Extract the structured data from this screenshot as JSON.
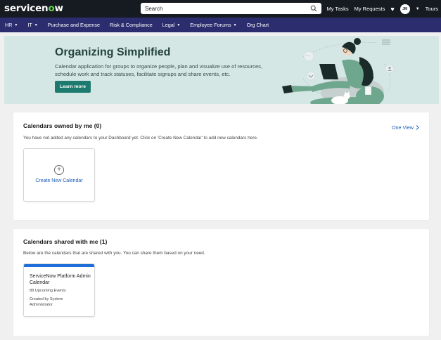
{
  "header": {
    "logo_text": "servicenow",
    "search_placeholder": "Search",
    "my_tasks": "My Tasks",
    "my_requests": "My Requests",
    "avatar_initials": "JM",
    "tours": "Tours"
  },
  "nav": {
    "items": [
      {
        "label": "HR",
        "has_dropdown": true
      },
      {
        "label": "IT",
        "has_dropdown": true
      },
      {
        "label": "Purchase and Expense",
        "has_dropdown": false
      },
      {
        "label": "Risk & Compliance",
        "has_dropdown": false
      },
      {
        "label": "Legal",
        "has_dropdown": true
      },
      {
        "label": "Employee Forums",
        "has_dropdown": true
      },
      {
        "label": "Org Chart",
        "has_dropdown": false
      }
    ]
  },
  "banner": {
    "title": "Organizing Simplified",
    "description": "Calendar application for groups to organize people, plan and visualize use of resources, schedule work and track statuses, facilitate signups and share events, etc.",
    "button_label": "Learn more"
  },
  "owned": {
    "title": "Calendars owned by me (0)",
    "one_view": "One View",
    "description": "You have not added any calendars to your Dashboard yet. Click on 'Create New Calendar' to add new calendars here.",
    "create_label": "Create New Calendar"
  },
  "shared": {
    "title": "Calendars shared with me (1)",
    "description": "Below are the calendars that are shared with you. You can share them based on your need.",
    "calendar": {
      "name": "ServiceNow Platform Admin Calendar",
      "events": "88 Upcoming Events",
      "created_by": "Created by System Administrator"
    }
  },
  "colors": {
    "header_bg": "#161b21",
    "nav_bg": "#2c2d6f",
    "banner_bg": "#d5e7e5",
    "button_bg": "#1d7a6e",
    "link": "#1f5fb8",
    "card_accent": "#1f6fd8"
  }
}
